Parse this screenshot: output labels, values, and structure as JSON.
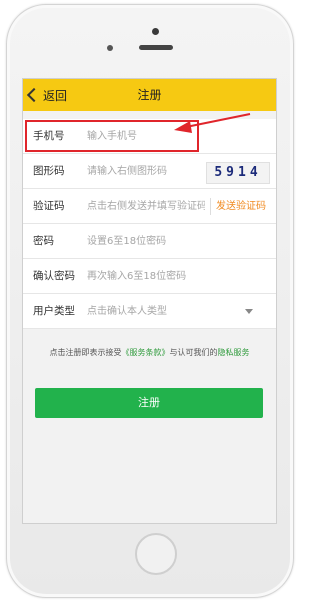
{
  "header": {
    "back_label": "返回",
    "title": "注册"
  },
  "form": {
    "phone": {
      "label": "手机号",
      "placeholder": "输入手机号"
    },
    "captcha": {
      "label": "图形码",
      "placeholder": "请输入右侧图形码",
      "code": "5914"
    },
    "sms": {
      "label": "验证码",
      "placeholder": "点击右侧发送并填写验证码",
      "button": "发送验证码"
    },
    "password": {
      "label": "密码",
      "placeholder": "设置6至18位密码"
    },
    "confirm": {
      "label": "确认密码",
      "placeholder": "再次输入6至18位密码"
    },
    "user_type": {
      "label": "用户类型",
      "placeholder": "点击确认本人类型"
    }
  },
  "agreement": {
    "prefix": "点击注册即表示接受",
    "terms": "《服务条款》",
    "middle": "与认可我们的",
    "privacy": "隐私服务"
  },
  "submit_label": "注册",
  "colors": {
    "header": "#f6c912",
    "submit": "#22b24c",
    "link": "#2f9b3c",
    "sms": "#f08a1f",
    "annotation": "#e0252b"
  }
}
